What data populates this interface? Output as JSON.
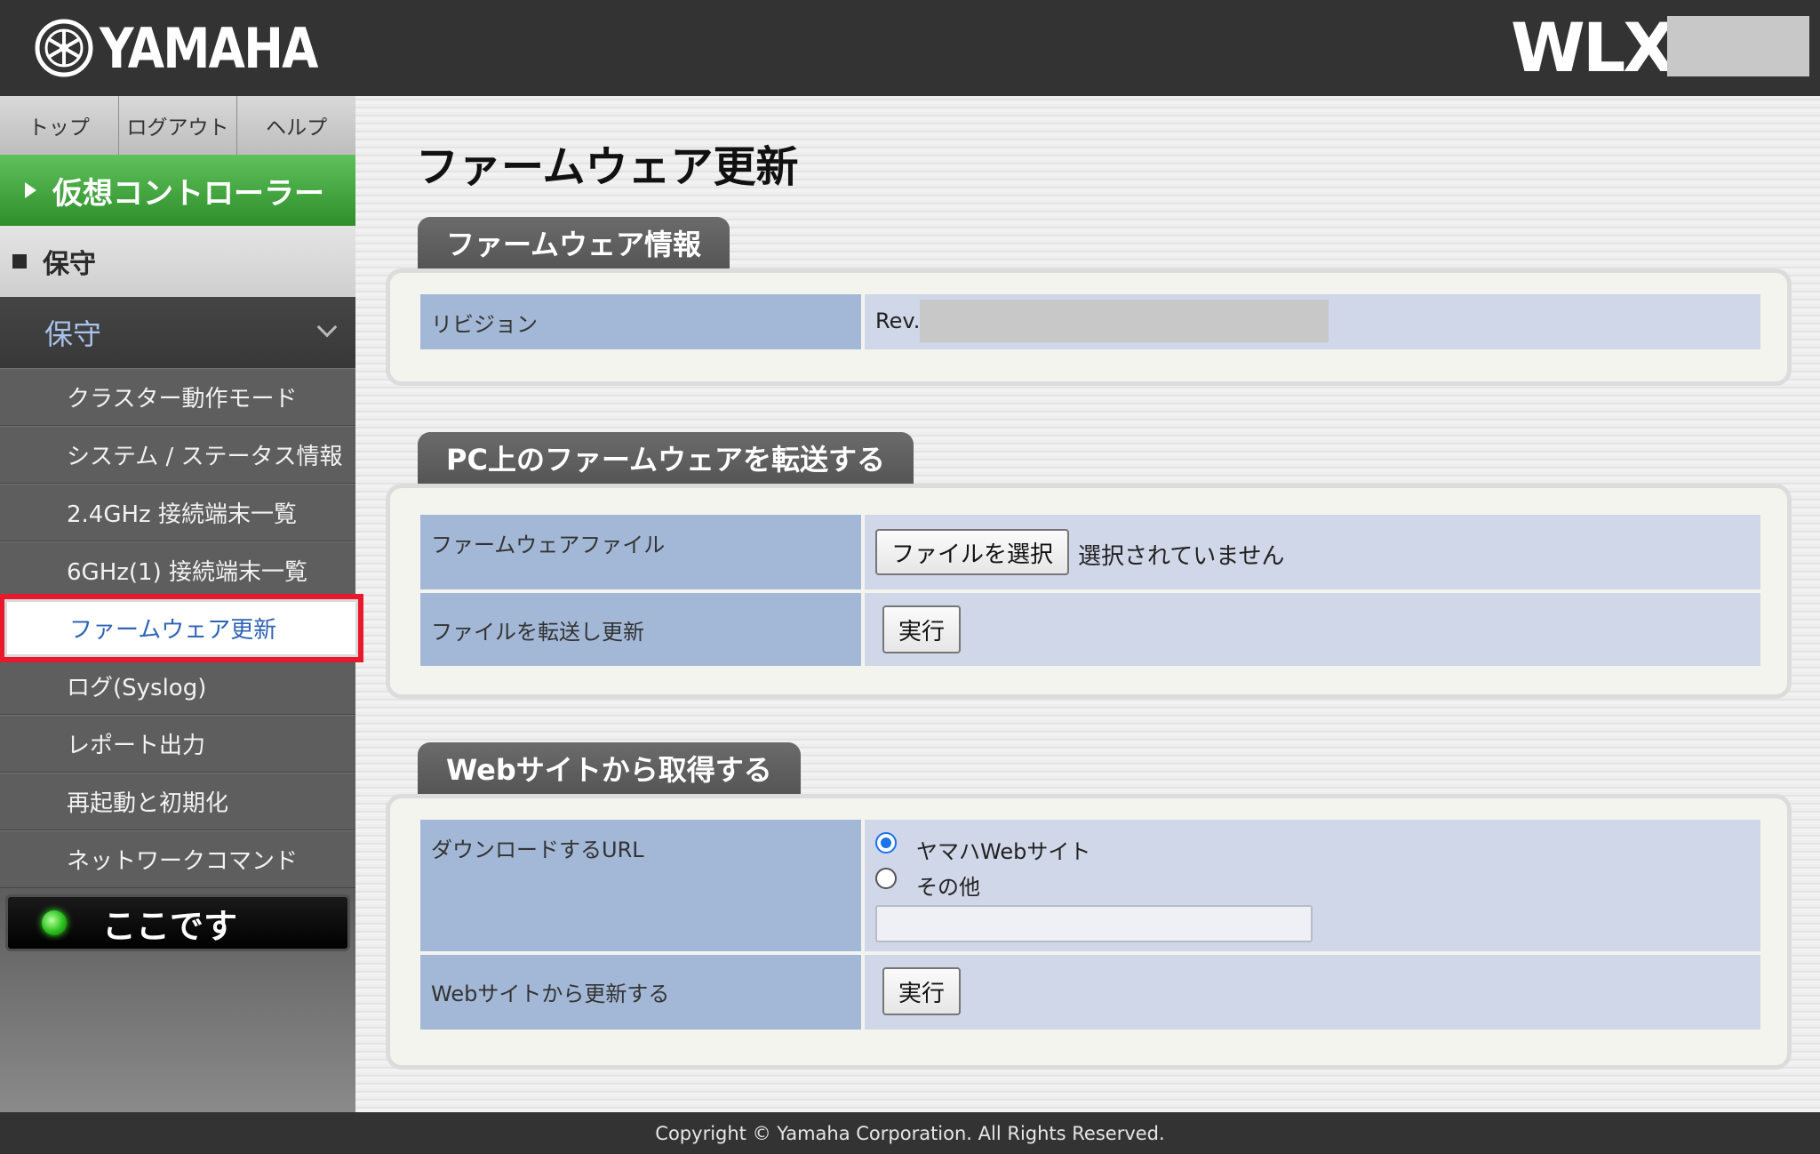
{
  "header": {
    "brand": "YAMAHA",
    "model": "WLX"
  },
  "sidebar": {
    "topnav": [
      "トップ",
      "ログアウト",
      "ヘルプ"
    ],
    "virtual_controller": "仮想コントローラー",
    "maintenance_header": "保守",
    "maintenance_group": "保守",
    "menu": [
      "クラスター動作モード",
      "システム / ステータス情報",
      "2.4GHz 接続端末一覧",
      "6GHz(1) 接続端末一覧",
      "ファームウェア更新",
      "ログ(Syslog)",
      "レポート出力",
      "再起動と初期化",
      "ネットワークコマンド"
    ],
    "active_index": 4,
    "here_button": "ここです"
  },
  "main": {
    "title": "ファームウェア更新",
    "info": {
      "tab": "ファームウェア情報",
      "revision_label": "リビジョン",
      "revision_prefix": "Rev."
    },
    "pc_transfer": {
      "tab": "PC上のファームウェアを転送する",
      "file_label": "ファームウェアファイル",
      "choose_button": "ファイルを選択",
      "no_file_text": "選択されていません",
      "transfer_label": "ファイルを転送し更新",
      "execute_button": "実行"
    },
    "web": {
      "tab": "Webサイトから取得する",
      "url_label": "ダウンロードするURL",
      "option_yamaha": "ヤマハWebサイト",
      "option_other": "その他",
      "other_url_value": "",
      "update_label": "Webサイトから更新する",
      "execute_button": "実行"
    }
  },
  "footer": {
    "copyright": "Copyright © Yamaha Corporation. All Rights Reserved."
  }
}
